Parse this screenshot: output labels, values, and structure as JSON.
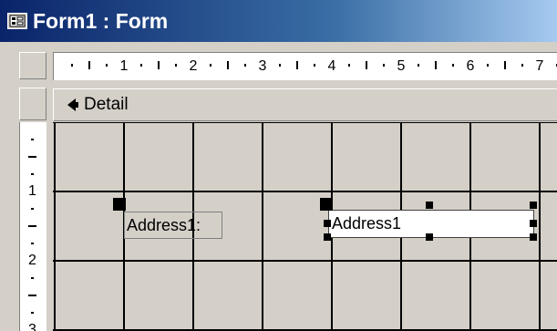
{
  "window": {
    "title": "Form1 : Form",
    "icon": "form-icon"
  },
  "ruler_horizontal": {
    "labels": [
      "1",
      "2",
      "3",
      "4",
      "5",
      "6",
      "7"
    ]
  },
  "ruler_vertical": {
    "labels": [
      "1",
      "2",
      "3"
    ]
  },
  "section": {
    "label": "Detail",
    "icon": "section-arrow-icon"
  },
  "controls": {
    "label": {
      "text": "Address1:"
    },
    "textbox": {
      "text": "Address1"
    }
  }
}
